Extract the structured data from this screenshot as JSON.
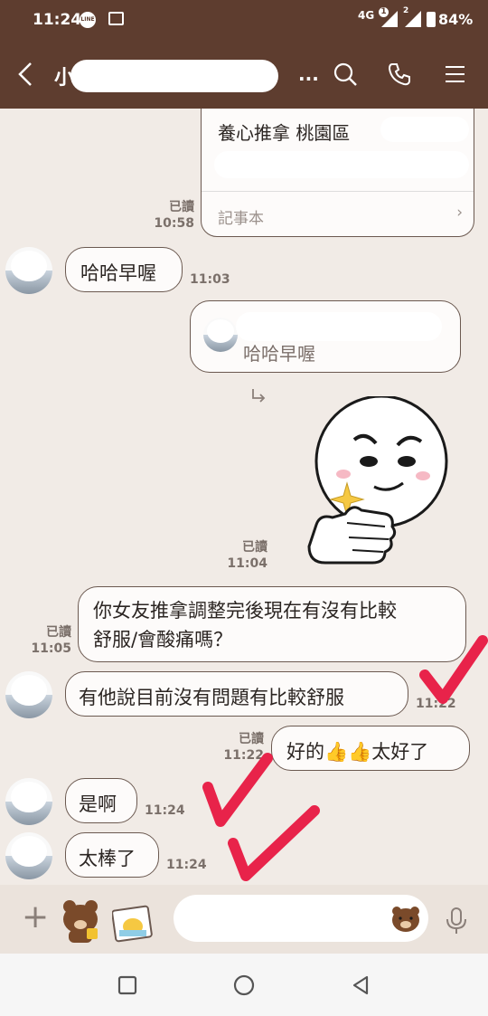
{
  "status_bar": {
    "time": "11:24",
    "line_badge": "LINE",
    "network": "4G",
    "sim1": "1",
    "sim2": "2",
    "battery": "84%"
  },
  "header": {
    "title": "小",
    "ellipsis": "...",
    "icons": [
      "back-icon",
      "search-icon",
      "phone-icon",
      "menu-icon"
    ]
  },
  "messages": {
    "note_card": {
      "line1": "養心推拿 桃園區",
      "footer": "記事本",
      "read": "已讀",
      "time": "10:58"
    },
    "msg1": {
      "text": "哈哈早喔",
      "time": "11:03"
    },
    "reply_card": {
      "quoted": "哈哈早喔"
    },
    "sticker": {
      "read": "已讀",
      "time": "11:04"
    },
    "msg2": {
      "line1": "你女友推拿調整完後現在有沒有比較",
      "line2": "舒服/會酸痛嗎？",
      "read": "已讀",
      "time": "11:05"
    },
    "msg3": {
      "text": "有他說目前沒有問題有比較舒服",
      "time": "11:22"
    },
    "msg4": {
      "text": "好的👍👍太好了",
      "read": "已讀",
      "time": "11:22"
    },
    "msg5": {
      "text": "是啊",
      "time": "11:24"
    },
    "msg6": {
      "text": "太棒了",
      "time": "11:24"
    }
  },
  "input": {
    "placeholder": ""
  },
  "colors": {
    "header": "#5e3d2f",
    "background": "#f1ebe6",
    "bubble_border": "#6b5950",
    "annotation": "#e8234a"
  }
}
